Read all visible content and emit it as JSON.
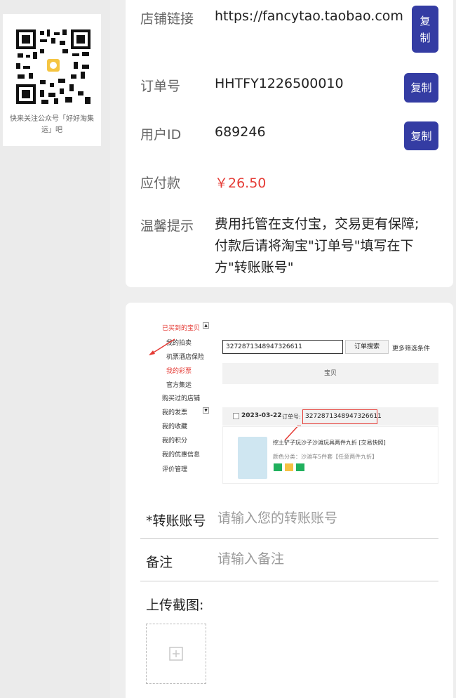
{
  "qr": {
    "caption": "快来关注公众号「好好淘集运」吧"
  },
  "info": {
    "rows": [
      {
        "label": "店铺链接",
        "value": "https://fancytao.taobao.com",
        "copy": "复制"
      },
      {
        "label": "订单号",
        "value": "HHTFY1226500010",
        "copy": "复制"
      },
      {
        "label": "用户ID",
        "value": "689246",
        "copy": "复制"
      },
      {
        "label": "应付款",
        "value": "￥26.50"
      },
      {
        "label": "温馨提示",
        "value": "费用托管在支付宝，交易更有保障;付款后请将淘宝\"订单号\"填写在下方\"转账账号\""
      }
    ]
  },
  "example": {
    "menu": [
      "已买到的宝贝",
      "我的拍卖",
      "机票酒店保险",
      "我的彩票",
      "官方集运",
      "购买过的店铺",
      "我的发票",
      "我的收藏",
      "我的积分",
      "我的优惠信息",
      "评价管理"
    ],
    "search_value": "3272871348947326611",
    "search_button": "订单搜索",
    "more_filter": "更多筛选条件",
    "column_header": "宝贝",
    "order_date": "2023-03-22",
    "order_prefix": "订单号:",
    "order_number": "3272871348947326611",
    "product_title": "挖土铲子玩沙子沙滩玩具两件九折 [交易快照]",
    "product_spec": "颜色分类：沙滩车5件套【任意两件九折】"
  },
  "form": {
    "transfer_label": "*转账账号",
    "transfer_placeholder": "请输入您的转账账号",
    "remark_label": "备注",
    "remark_placeholder": "请输入备注",
    "upload_label": "上传截图:"
  },
  "colors": {
    "accent": "#343ca3",
    "price": "#e53b35"
  }
}
